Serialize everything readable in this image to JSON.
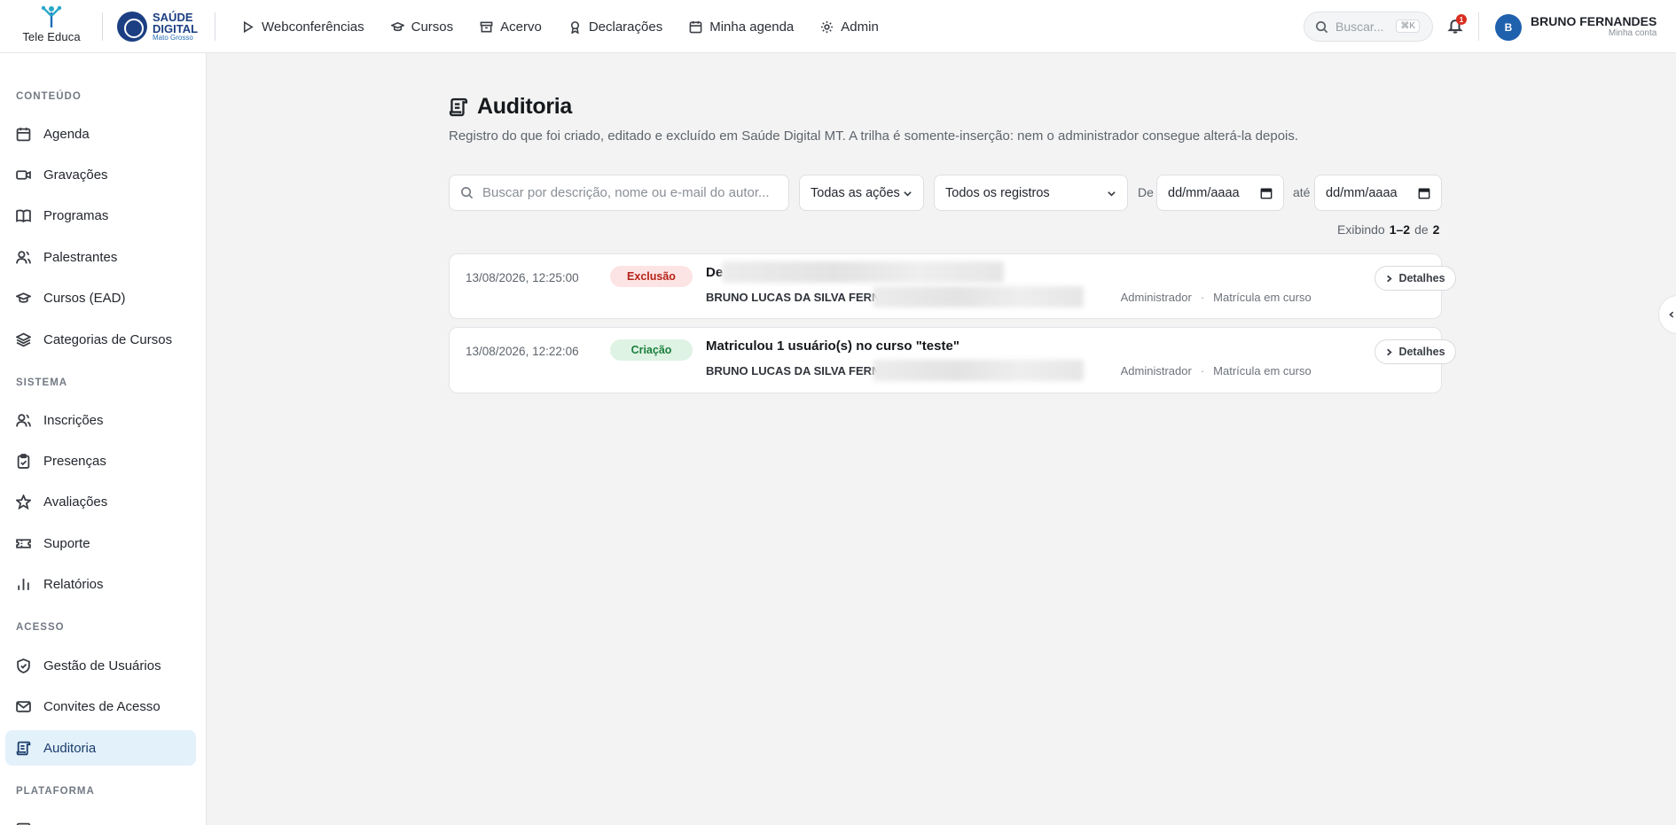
{
  "header": {
    "brand_text": "Tele Educa",
    "partner": {
      "line1": "SAÚDE",
      "line2": "DIGITAL",
      "line3": "Mato Grosso"
    },
    "nav": [
      {
        "label": "Webconferências",
        "icon": "play-icon"
      },
      {
        "label": "Cursos",
        "icon": "graduation-cap-icon"
      },
      {
        "label": "Acervo",
        "icon": "archive-icon"
      },
      {
        "label": "Declarações",
        "icon": "award-icon"
      },
      {
        "label": "Minha agenda",
        "icon": "calendar-icon"
      },
      {
        "label": "Admin",
        "icon": "gear-icon"
      }
    ],
    "search_placeholder": "Buscar...",
    "search_shortcut": "⌘K",
    "notifications_count": "1",
    "user": {
      "initial": "B",
      "name": "BRUNO FERNANDES",
      "sub": "Minha conta"
    }
  },
  "sidebar": {
    "sections": [
      {
        "title": "CONTEÚDO",
        "items": [
          {
            "label": "Agenda",
            "icon": "calendar-icon"
          },
          {
            "label": "Gravações",
            "icon": "video-icon"
          },
          {
            "label": "Programas",
            "icon": "book-icon"
          },
          {
            "label": "Palestrantes",
            "icon": "users-icon"
          },
          {
            "label": "Cursos (EAD)",
            "icon": "graduation-cap-icon"
          },
          {
            "label": "Categorias de Cursos",
            "icon": "layers-icon"
          }
        ]
      },
      {
        "title": "SISTEMA",
        "items": [
          {
            "label": "Inscrições",
            "icon": "users-icon"
          },
          {
            "label": "Presenças",
            "icon": "clipboard-check-icon"
          },
          {
            "label": "Avaliações",
            "icon": "star-icon"
          },
          {
            "label": "Suporte",
            "icon": "ticket-icon"
          },
          {
            "label": "Relatórios",
            "icon": "bar-chart-icon"
          }
        ]
      },
      {
        "title": "ACESSO",
        "items": [
          {
            "label": "Gestão de Usuários",
            "icon": "shield-check-icon"
          },
          {
            "label": "Convites de Acesso",
            "icon": "mail-icon"
          },
          {
            "label": "Auditoria",
            "icon": "scroll-icon",
            "active": true
          }
        ]
      },
      {
        "title": "PLATAFORMA",
        "items": []
      }
    ]
  },
  "page": {
    "title": "Auditoria",
    "subtitle": "Registro do que foi criado, editado e excluído em Saúde Digital MT. A trilha é somente-inserção: nem o administrador consegue alterá-la depois.",
    "filters": {
      "search_placeholder": "Buscar por descrição, nome ou e-mail do autor...",
      "action_select": "Todas as ações",
      "records_select": "Todos os registros",
      "from_label": "De",
      "to_label": "até",
      "date_from": "dd/mm/aaaa",
      "date_to": "dd/mm/aaaa"
    },
    "showing": {
      "prefix": "Exibindo",
      "range": "1–2",
      "of": "de",
      "total": "2"
    },
    "rows": [
      {
        "timestamp": "13/08/2026, 12:25:00",
        "action": "Exclusão",
        "action_type": "delete",
        "description": "De",
        "author": "BRUNO LUCAS DA SILVA FERNAND",
        "role": "Administrador",
        "entity": "Matrícula em curso",
        "details_label": "Detalhes"
      },
      {
        "timestamp": "13/08/2026, 12:22:06",
        "action": "Criação",
        "action_type": "create",
        "description": "Matriculou 1 usuário(s) no curso \"teste\"",
        "author": "BRUNO LUCAS DA SILVA FERNAND",
        "role": "Administrador",
        "entity": "Matrícula em curso",
        "details_label": "Detalhes"
      }
    ]
  }
}
